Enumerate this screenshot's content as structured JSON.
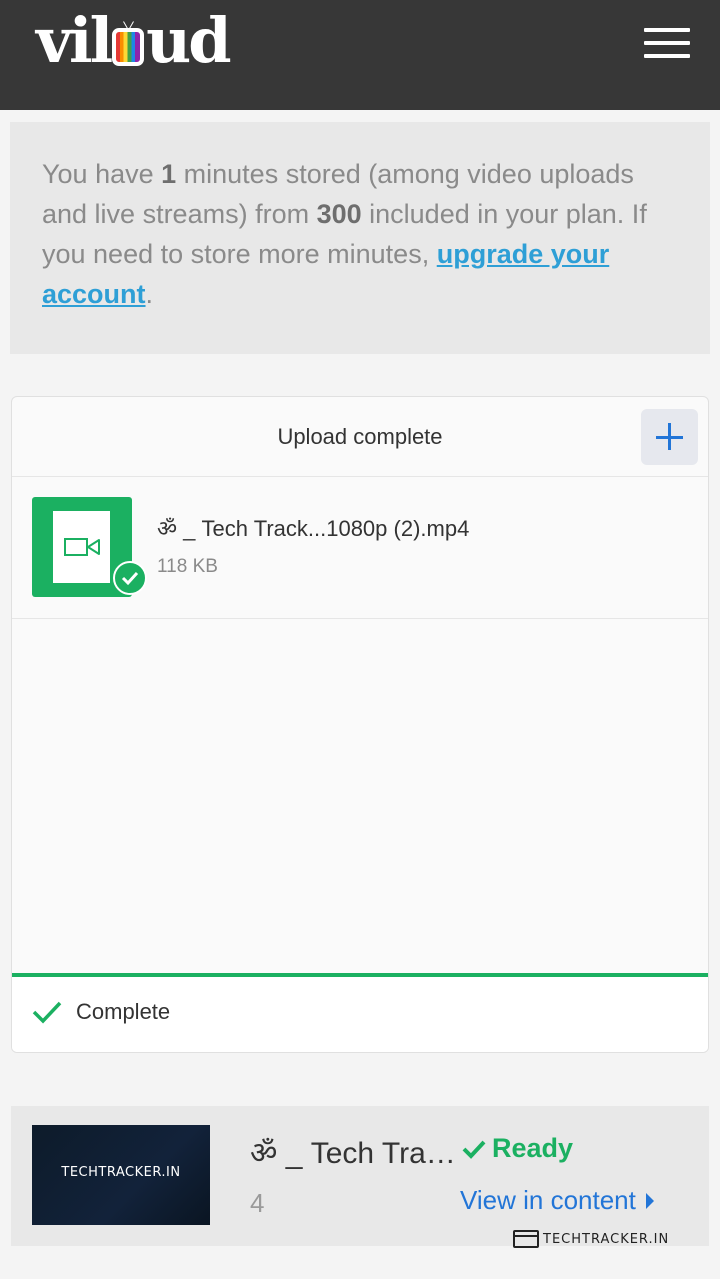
{
  "header": {
    "logo_text_left": "vil",
    "logo_text_right": "ud",
    "menu_icon": "hamburger-menu-icon"
  },
  "notice": {
    "text_1": "You have ",
    "minutes_used": "1",
    "text_2": " minutes stored (among video uploads and live streams) from ",
    "minutes_included": "300",
    "text_3": " included in your plan. If you need to store more minutes, ",
    "link_label": "upgrade your account",
    "text_4": "."
  },
  "uploader": {
    "title": "Upload complete",
    "add_icon": "plus-icon",
    "file": {
      "name": "ॐ _ Tech Track...1080p (2).mp4",
      "size": "118 KB",
      "icon": "video-camera-icon"
    },
    "progress": 1.0,
    "status_label": "Complete"
  },
  "video": {
    "thumbnail_brand": "TECHTRACKER.IN",
    "title": "ॐ _ Tech Tracker",
    "status_label": "Ready",
    "count": "4",
    "view_link_label": "View in content"
  },
  "watermark": {
    "text": "TECHTRACKER.IN"
  },
  "colors": {
    "header_bg": "#373737",
    "accent_green": "#1bb061",
    "link_blue": "#2275d7",
    "notice_link": "#2e9fd6"
  }
}
